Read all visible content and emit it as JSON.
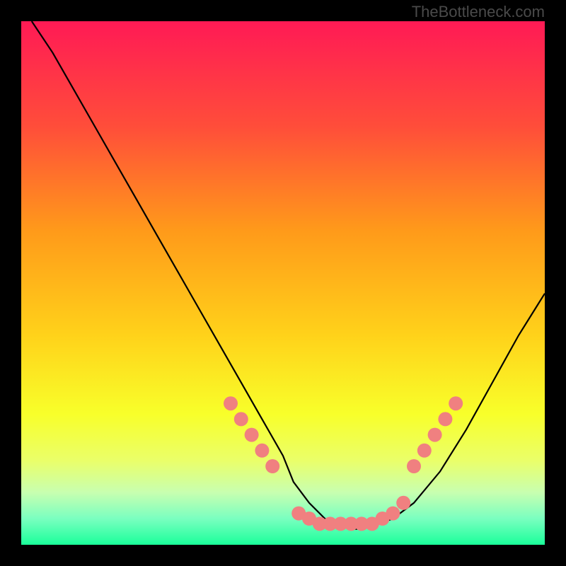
{
  "watermark": "TheBottleneck.com",
  "chart_data": {
    "type": "line",
    "title": "",
    "xlabel": "",
    "ylabel": "",
    "xlim": [
      0,
      100
    ],
    "ylim": [
      0,
      100
    ],
    "gradient_stops": [
      {
        "offset": 0,
        "color": "#ff1a55"
      },
      {
        "offset": 20,
        "color": "#ff4d3a"
      },
      {
        "offset": 40,
        "color": "#ff9a1a"
      },
      {
        "offset": 60,
        "color": "#ffd21a"
      },
      {
        "offset": 75,
        "color": "#f8ff2a"
      },
      {
        "offset": 84,
        "color": "#eaff6a"
      },
      {
        "offset": 90,
        "color": "#c8ffb0"
      },
      {
        "offset": 95,
        "color": "#7affc0"
      },
      {
        "offset": 100,
        "color": "#1aff9a"
      }
    ],
    "series": [
      {
        "name": "curve",
        "x": [
          2,
          6,
          10,
          14,
          18,
          22,
          26,
          30,
          34,
          38,
          42,
          46,
          50,
          52,
          55,
          58,
          61,
          64,
          67,
          71,
          75,
          80,
          85,
          90,
          95,
          100
        ],
        "y": [
          100,
          94,
          87,
          80,
          73,
          66,
          59,
          52,
          45,
          38,
          31,
          24,
          17,
          12,
          8,
          5,
          3.5,
          3,
          3.5,
          5,
          8,
          14,
          22,
          31,
          40,
          48
        ]
      }
    ],
    "markers": {
      "name": "dots",
      "color": "#f08080",
      "radius": 10,
      "points": [
        {
          "x": 40,
          "y": 27
        },
        {
          "x": 42,
          "y": 24
        },
        {
          "x": 44,
          "y": 21
        },
        {
          "x": 46,
          "y": 18
        },
        {
          "x": 48,
          "y": 15
        },
        {
          "x": 53,
          "y": 6
        },
        {
          "x": 55,
          "y": 5
        },
        {
          "x": 57,
          "y": 4
        },
        {
          "x": 59,
          "y": 4
        },
        {
          "x": 61,
          "y": 4
        },
        {
          "x": 63,
          "y": 4
        },
        {
          "x": 65,
          "y": 4
        },
        {
          "x": 67,
          "y": 4
        },
        {
          "x": 69,
          "y": 5
        },
        {
          "x": 71,
          "y": 6
        },
        {
          "x": 73,
          "y": 8
        },
        {
          "x": 75,
          "y": 15
        },
        {
          "x": 77,
          "y": 18
        },
        {
          "x": 79,
          "y": 21
        },
        {
          "x": 81,
          "y": 24
        },
        {
          "x": 83,
          "y": 27
        }
      ]
    }
  }
}
